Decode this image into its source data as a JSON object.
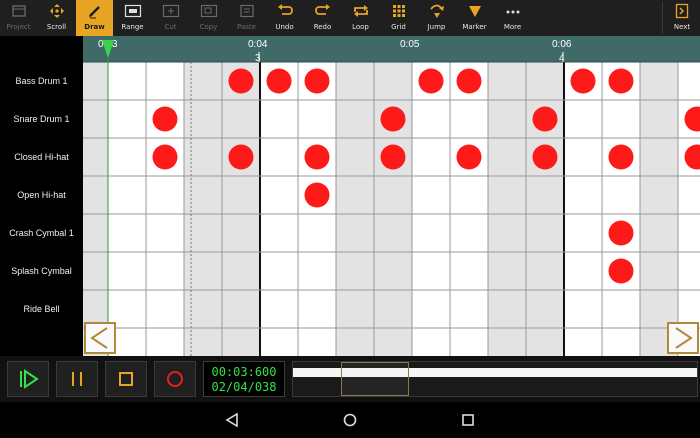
{
  "toolbar": {
    "buttons": [
      {
        "label": "Project",
        "icon": "folder-icon",
        "state": "disabled"
      },
      {
        "label": "Scroll",
        "icon": "move-arrows-icon",
        "state": "normal"
      },
      {
        "label": "Draw",
        "icon": "pencil-icon",
        "state": "active"
      },
      {
        "label": "Range",
        "icon": "range-select-icon",
        "state": "normal"
      },
      {
        "label": "Cut",
        "icon": "cut-icon",
        "state": "disabled"
      },
      {
        "label": "Copy",
        "icon": "copy-icon",
        "state": "disabled"
      },
      {
        "label": "Paste",
        "icon": "paste-icon",
        "state": "disabled"
      },
      {
        "label": "Undo",
        "icon": "undo-icon",
        "state": "normal"
      },
      {
        "label": "Redo",
        "icon": "redo-icon",
        "state": "normal"
      },
      {
        "label": "Loop",
        "icon": "loop-icon",
        "state": "normal"
      },
      {
        "label": "Grid",
        "icon": "grid-icon",
        "state": "normal"
      },
      {
        "label": "Jump",
        "icon": "jump-icon",
        "state": "normal"
      },
      {
        "label": "Marker",
        "icon": "marker-icon",
        "state": "normal"
      },
      {
        "label": "More",
        "icon": "more-icon",
        "state": "normal"
      }
    ],
    "next_label": "Next",
    "accent_color": "#e8a524"
  },
  "ruler": {
    "time_labels": [
      "0:03",
      "0:04",
      "0:05",
      "0:06"
    ],
    "bar_labels": [
      "3",
      "4"
    ]
  },
  "tracks": [
    {
      "name": "Bass Drum 1"
    },
    {
      "name": "Snare Drum 1"
    },
    {
      "name": "Closed Hi-hat"
    },
    {
      "name": "Open Hi-hat"
    },
    {
      "name": "Crash Cymbal 1"
    },
    {
      "name": "Splash Cymbal"
    },
    {
      "name": "Ride Bell"
    }
  ],
  "notes": [
    {
      "row": 0,
      "step": 3
    },
    {
      "row": 0,
      "step": 4
    },
    {
      "row": 0,
      "step": 5
    },
    {
      "row": 0,
      "step": 8
    },
    {
      "row": 0,
      "step": 9
    },
    {
      "row": 0,
      "step": 12
    },
    {
      "row": 0,
      "step": 13
    },
    {
      "row": 1,
      "step": 1
    },
    {
      "row": 1,
      "step": 7
    },
    {
      "row": 1,
      "step": 11
    },
    {
      "row": 1,
      "step": 15
    },
    {
      "row": 2,
      "step": 1
    },
    {
      "row": 2,
      "step": 3
    },
    {
      "row": 2,
      "step": 5
    },
    {
      "row": 2,
      "step": 7
    },
    {
      "row": 2,
      "step": 9
    },
    {
      "row": 2,
      "step": 11
    },
    {
      "row": 2,
      "step": 13
    },
    {
      "row": 2,
      "step": 15
    },
    {
      "row": 3,
      "step": 5
    },
    {
      "row": 4,
      "step": 13
    },
    {
      "row": 5,
      "step": 13
    }
  ],
  "note_color": "#ff1a1a",
  "scroll_left_icon": "chevron-left-icon",
  "scroll_right_icon": "chevron-right-icon",
  "transport": {
    "play_icon": "play-from-start-icon",
    "pause_icon": "pause-icon",
    "stop_icon": "stop-icon",
    "record_icon": "record-icon",
    "time": "00:03:600",
    "position": "02/04/038",
    "display_color": "#34e34a"
  },
  "navbar": {
    "back_icon": "back-triangle-icon",
    "home_icon": "home-circle-icon",
    "recents_icon": "recents-square-icon"
  }
}
